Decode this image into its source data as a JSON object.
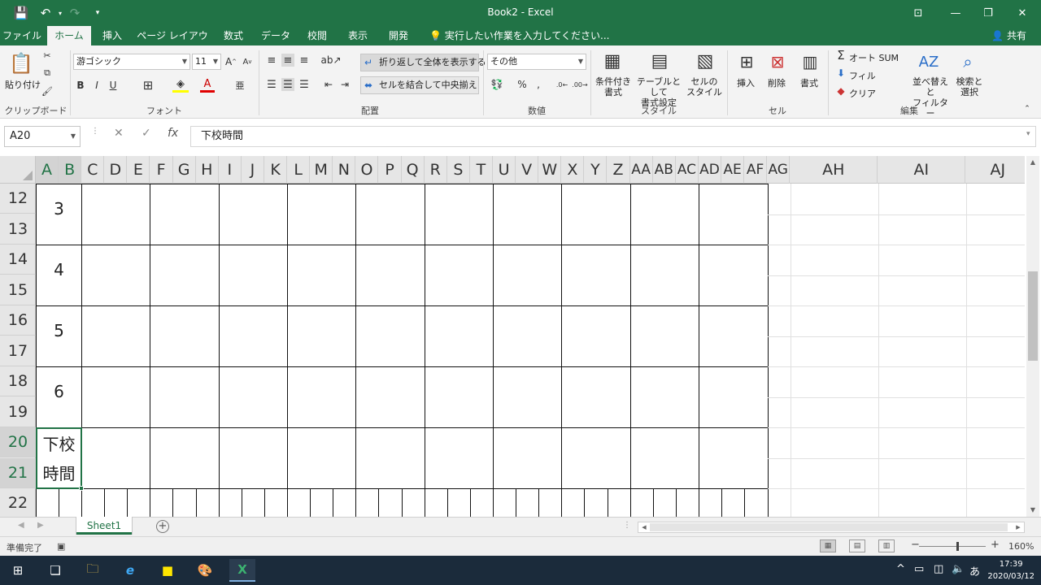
{
  "window": {
    "title": "Book2 - Excel"
  },
  "menu": {
    "tabs": [
      "ファイル",
      "ホーム",
      "挿入",
      "ページ レイアウト",
      "数式",
      "データ",
      "校閲",
      "表示",
      "開発"
    ],
    "active_tab": "ホーム",
    "tell_me": "実行したい作業を入力してください...",
    "share": "共有"
  },
  "ribbon": {
    "clipboard": {
      "paste": "貼り付け",
      "label": "クリップボード"
    },
    "font": {
      "name": "游ゴシック",
      "size": "11",
      "label": "フォント",
      "bold": "B",
      "italic": "I",
      "underline": "U"
    },
    "alignment": {
      "wrap_text": "折り返して全体を表示する",
      "merge_center": "セルを結合して中央揃え",
      "label": "配置"
    },
    "number": {
      "format": "その他",
      "label": "数値"
    },
    "styles": {
      "conditional": "条件付き\n書式",
      "table": "テーブルとして\n書式設定",
      "cell_styles": "セルの\nスタイル",
      "label": "スタイル"
    },
    "cells": {
      "insert": "挿入",
      "delete": "削除",
      "format": "書式",
      "label": "セル"
    },
    "editing": {
      "autosum": "オート SUM",
      "fill": "フィル",
      "clear": "クリア",
      "sort": "並べ替えと\nフィルター",
      "find": "検索と\n選択",
      "label": "編集"
    }
  },
  "formula_bar": {
    "name_box": "A20",
    "formula": "下校時間"
  },
  "columns": [
    "A",
    "B",
    "C",
    "D",
    "E",
    "F",
    "G",
    "H",
    "I",
    "J",
    "K",
    "L",
    "M",
    "N",
    "O",
    "P",
    "Q",
    "R",
    "S",
    "T",
    "U",
    "V",
    "W",
    "X",
    "Y",
    "Z",
    "AA",
    "AB",
    "AC",
    "AD",
    "AE",
    "AF",
    "AG",
    "AH",
    "AI",
    "AJ"
  ],
  "rows": [
    "12",
    "13",
    "14",
    "15",
    "16",
    "17",
    "18",
    "19",
    "20",
    "21",
    "22"
  ],
  "cells": {
    "r12_13": "3",
    "r14_15": "4",
    "r16_17": "5",
    "r18_19": "6",
    "r20_line1": "下校",
    "r21_line2": "時間"
  },
  "sheet_tabs": [
    "Sheet1"
  ],
  "status": {
    "ready": "準備完了",
    "zoom": "160%"
  },
  "taskbar": {
    "time": "17:39",
    "date": "2020/03/12",
    "ime": "あ"
  },
  "colors": {
    "accent": "#217346",
    "taskbar": "#1b2b3b"
  }
}
